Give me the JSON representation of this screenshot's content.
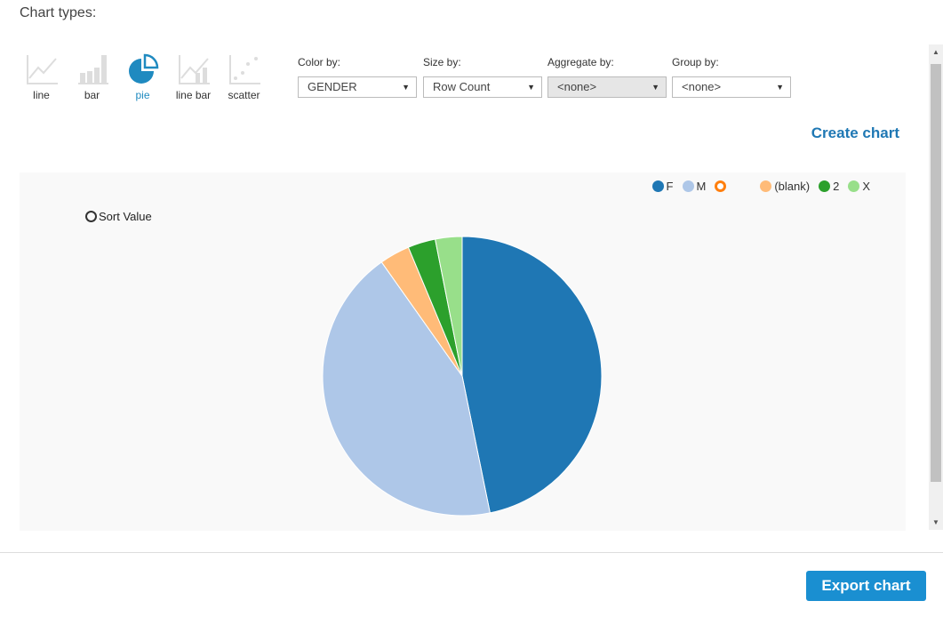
{
  "title": "Chart types:",
  "chart_types": [
    {
      "label": "line",
      "icon": "line-chart-icon"
    },
    {
      "label": "bar",
      "icon": "bar-chart-icon"
    },
    {
      "label": "pie",
      "icon": "pie-chart-icon",
      "active": true
    },
    {
      "label": "line bar",
      "icon": "line-bar-chart-icon"
    },
    {
      "label": "scatter",
      "icon": "scatter-chart-icon"
    }
  ],
  "controls": [
    {
      "label": "Color by:",
      "value": "GENDER"
    },
    {
      "label": "Size by:",
      "value": "Row Count"
    },
    {
      "label": "Aggregate by:",
      "value": "<none>",
      "disabled": true
    },
    {
      "label": "Group by:",
      "value": "<none>"
    }
  ],
  "create_label": "Create chart",
  "sort_label": "Sort Value",
  "export_label": "Export chart",
  "accent": "#1f8ac0",
  "chart_data": {
    "type": "pie",
    "categories": [
      "F",
      "M",
      "",
      "(blank)",
      "2",
      "X"
    ],
    "values": [
      46.8,
      43.4,
      0,
      3.5,
      3.2,
      3.1
    ],
    "colors": [
      "#1f77b4",
      "#aec7e8",
      "#ff7f0e",
      "#ffbb78",
      "#2ca02c",
      "#98df8a"
    ]
  }
}
